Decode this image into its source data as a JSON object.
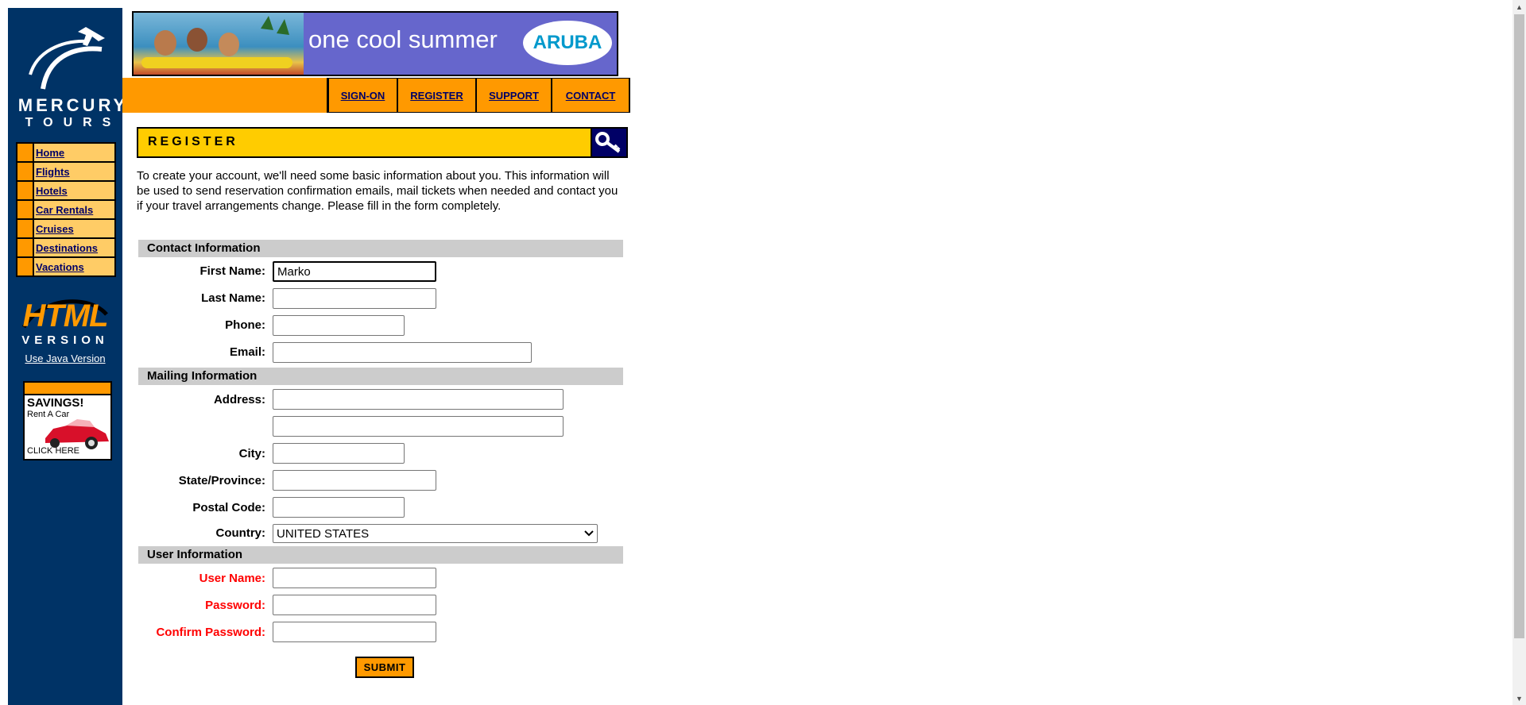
{
  "logo": {
    "word1": "MERCURY",
    "word2": "TOURS"
  },
  "side_nav": [
    {
      "label": "Home"
    },
    {
      "label": "Flights"
    },
    {
      "label": "Hotels"
    },
    {
      "label": "Car Rentals"
    },
    {
      "label": "Cruises"
    },
    {
      "label": "Destinations"
    },
    {
      "label": "Vacations"
    }
  ],
  "html_badge": {
    "html": "HTML",
    "version": "VERSION",
    "java_link": "Use Java Version"
  },
  "ad": {
    "title": "SAVINGS!",
    "subtitle": "Rent A Car",
    "cta": "CLICK HERE"
  },
  "banner": {
    "text": "one cool summer",
    "logo": "ARUBA"
  },
  "top_nav": {
    "signon": "SIGN-ON",
    "register": "REGISTER",
    "support": "SUPPORT",
    "contact": "CONTACT"
  },
  "page": {
    "title": "REGISTER",
    "intro": "To create your account, we'll need some basic information about you. This information will be used to send reservation confirmation emails, mail tickets when needed and contact you if your travel arrangements change. Please fill in the form completely."
  },
  "contact": {
    "heading": "Contact Information",
    "first_name_label": "First Name:",
    "first_name_value": "Marko",
    "last_name_label": "Last Name:",
    "phone_label": "Phone:",
    "email_label": "Email:"
  },
  "mailing": {
    "heading": "Mailing Information",
    "address_label": "Address:",
    "city_label": "City:",
    "state_label": "State/Province:",
    "postal_label": "Postal Code:",
    "country_label": "Country:",
    "country_value": "UNITED STATES"
  },
  "user": {
    "heading": "User Information",
    "username_label": "User Name:",
    "password_label": "Password:",
    "confirm_label": "Confirm Password:"
  },
  "submit_label": "SUBMIT",
  "colors": {
    "left_panel": "#003366",
    "orange": "#ff9900",
    "header_yellow": "#ffcc00",
    "section_gray": "#cccccc",
    "required_red": "#ff0000"
  }
}
